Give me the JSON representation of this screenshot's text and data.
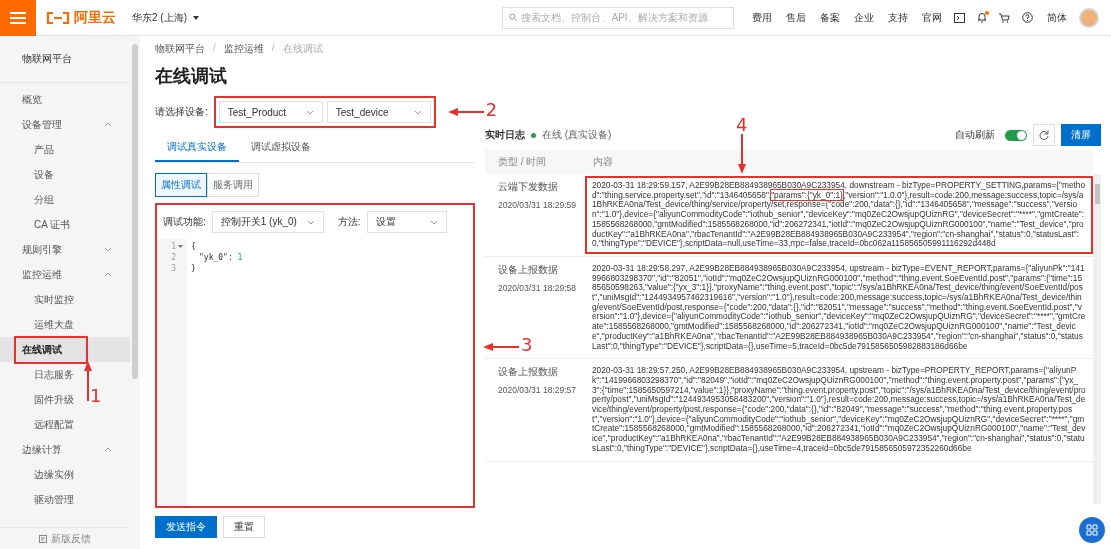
{
  "topbar": {
    "brand": "阿里云",
    "region": "华东2 (上海)",
    "search": {
      "placeholder": "搜索文档、控制台、API、解决方案和资源"
    },
    "links": [
      "费用",
      "售后",
      "备案",
      "企业",
      "支持",
      "官网"
    ],
    "language": "简体",
    "notification": true
  },
  "sidebar": {
    "title": "物联网平台",
    "items": [
      {
        "label": "概览",
        "selected": false
      },
      {
        "label": "设备管理",
        "selected": false,
        "expanded": true,
        "children": [
          {
            "label": "产品",
            "selected": false
          },
          {
            "label": "设备",
            "selected": false
          },
          {
            "label": "分组",
            "selected": false
          },
          {
            "label": "CA 证书",
            "selected": false
          }
        ]
      },
      {
        "label": "规则引擎",
        "selected": false,
        "expanded": false
      },
      {
        "label": "监控运维",
        "selected": false,
        "expanded": true,
        "children": [
          {
            "label": "实时监控",
            "selected": false
          },
          {
            "label": "运维大盘",
            "selected": false
          },
          {
            "label": "在线调试",
            "selected": true,
            "annotation": "1"
          },
          {
            "label": "日志服务",
            "selected": false
          },
          {
            "label": "固件升级",
            "selected": false
          },
          {
            "label": "远程配置",
            "selected": false
          }
        ]
      },
      {
        "label": "边缘计算",
        "selected": false,
        "expanded": true,
        "children": [
          {
            "label": "边缘实例",
            "selected": false
          },
          {
            "label": "驱动管理",
            "selected": false
          }
        ]
      }
    ],
    "feedback": "新版反馈"
  },
  "breadcrumb": {
    "separator": "/",
    "items": [
      "物联网平台",
      "监控运维",
      "在线调试"
    ]
  },
  "title": "在线调试",
  "device_select": {
    "label": "请选择设备:",
    "product": "Test_Product",
    "device": "Test_device",
    "annotation": "2"
  },
  "tabs": [
    {
      "label": "调试真实设备",
      "selected": true
    },
    {
      "label": "调试虚拟设备",
      "selected": false
    }
  ],
  "subtabs": [
    {
      "label": "属性调试",
      "selected": true
    },
    {
      "label": "服务调用",
      "selected": false
    }
  ],
  "editor": {
    "function_label": "调试功能:",
    "function": "控制开关1 (yk_0)",
    "method_label": "方法:",
    "method": "设置",
    "annotation": "3",
    "lines": [
      {
        "number": "1",
        "foldable": true,
        "code": "{"
      },
      {
        "number": "2",
        "foldable": false,
        "code": "\"yk_0\": ",
        "value": "1"
      },
      {
        "number": "3",
        "foldable": false,
        "code": "}"
      }
    ]
  },
  "buttons": [
    {
      "label": "发送指令",
      "primary": true
    },
    {
      "label": "重置",
      "primary": false
    }
  ],
  "log": {
    "title": "实时日志",
    "online": true,
    "status": "在线 (真实设备)",
    "auto_refresh_label": "自动刷新",
    "auto_refresh": true,
    "clear": "清屏",
    "columns": [
      "类型 / 时间",
      "内容"
    ],
    "rows": [
      {
        "type": "云端下发数据",
        "time": "2020/03/31 18:29:59",
        "annotation": "4",
        "content": "2020-03-31 18:29:59.157, A2E99B28EB884938965B030A9C233954, downstream - bizType=PROPERTY_SETTING,params={\"method\":\"thing.service.property.set\",\"id\":\"1346405658\",",
        "highlight": "\"params\":{\"yk_0\":1}",
        "content_after": ",\"version\":\"1.0.0\"},result=code:200,message:success,topic=/sys/a1BhRKEA0na/Test_device/thing/service/property/set,response={\"code\":200,\"data\":{},\"id\":\"1346405658\",\"message\":\"success\",\"version\":\"1.0\"},device={\"aliyunCommodityCode\":\"iothub_senior\",\"deviceKey\":\"mq0ZeC2OwsjupQUiznRG\",\"deviceSecret\":\"****\",\"gmtCreate\":1585568268000,\"gmtModified\":1585568268000,\"id\":206272341,\"iotId\":\"mq0ZeC2OwsjupQUiznRG000100\",\"name\":\"Test_device\",\"productKey\":\"a1BhRKEA0na\",\"rbacTenantId\":\"A2E99B28EB884938965B030A9C233954\",\"region\":\"cn-shanghai\",\"status\":0,\"statusLast\":0,\"thingType\":\"DEVICE\"},scriptData=null,useTime=33,rrpc=false,traceId=0bc062a115856505991116292d448d"
      },
      {
        "type": "设备上报数据",
        "time": "2020/03/31 18:29:58",
        "content": "2020-03-31 18:29:58.297, A2E99B28EB884938965B030A9C233954, upstream - bizType=EVENT_REPORT,params={\"aliyunPk\":\"1419966803298370\",\"id\":\"82051\",\"iotId\":\"mq0ZeC2OwsjupQUiznRG000100\",\"method\":\"thing.event.SoeEventId.post\",\"params\":{\"time\":1585650598263,\"value\":{\"yx_3\":1}},\"proxyName\":\"thing.event.post\",\"topic\":\"/sys/a1BhRKEA0na/Test_device/thing/event/SoeEventId/post\",\"uniMsgId\":\"1244934957462319616\",\"version\":\"1.0\"},result=code:200,message:success,topic=/sys/a1BhRKEA0na/Test_device/thing/event/SoeEventId/post,response={\"code\":200,\"data\":{},\"id\":\"82051\",\"message\":\"success\",\"method\":\"thing.event.SoeEventId.post\",\"version\":\"1.0\"},device={\"aliyunCommodityCode\":\"iothub_senior\",\"deviceKey\":\"mq0ZeC2OwsjupQUiznRG\",\"deviceSecret\":\"****\",\"gmtCreate\":1585568268000,\"gmtModified\":1585568268000,\"id\":206272341,\"iotId\":\"mq0ZeC2OwsjupQUiznRG000100\",\"name\":\"Test_device\",\"productKey\":\"a1BhRKEA0na\",\"rbacTenantId\":\"A2E99B28EB884938965B030A9C233954\",\"region\":\"cn-shanghai\",\"status\":0,\"statusLast\":0,\"thingType\":\"DEVICE\"},scriptData={},useTime=5,traceId=0bc5de7915856505982883186d66be"
      },
      {
        "type": "设备上报数据",
        "time": "2020/03/31 18:29:57",
        "content": "2020-03-31 18:29:57.250, A2E99B28EB884938965B030A9C233954, upstream - bizType=PROPERTY_REPORT,params={\"aliyunPk\":\"1419966803298370\",\"id\":\"82049\",\"iotId\":\"mq0ZeC2OwsjupQUiznRG000100\",\"method\":\"thing.event.property.post\",\"params\":{\"yx_3\":{\"time\":1585650597214,\"value\":1}},\"proxyName\":\"thing.event.property.post\",\"topic\":\"/sys/a1BhRKEA0na/Test_device/thing/event/property/post\",\"uniMsgId\":\"1244934953058483200\",\"version\":\"1.0\"},result=code:200,message:success,topic=/sys/a1BhRKEA0na/Test_device/thing/event/property/post,response={\"code\":200,\"data\":{},\"id\":\"82049\",\"message\":\"success\",\"method\":\"thing.event.property.post\",\"version\":\"1.0\"},device={\"aliyunCommodityCode\":\"iothub_senior\",\"deviceKey\":\"mq0ZeC2OwsjupQUiznRG\",\"deviceSecret\":\"****\",\"gmtCreate\":1585568268000,\"gmtModified\":1585568268000,\"id\":206272341,\"iotId\":\"mq0ZeC2OwsjupQUiznRG000100\",\"name\":\"Test_device\",\"productKey\":\"a1BhRKEA0na\",\"rbacTenantId\":\"A2E99B28EB884938965B030A9C233954\",\"region\":\"cn-shanghai\",\"status\":0,\"statusLast\":0,\"thingType\":\"DEVICE\"},scriptData={},useTime=4,traceId=0bc5de7915856505972352260d66be"
      }
    ]
  }
}
